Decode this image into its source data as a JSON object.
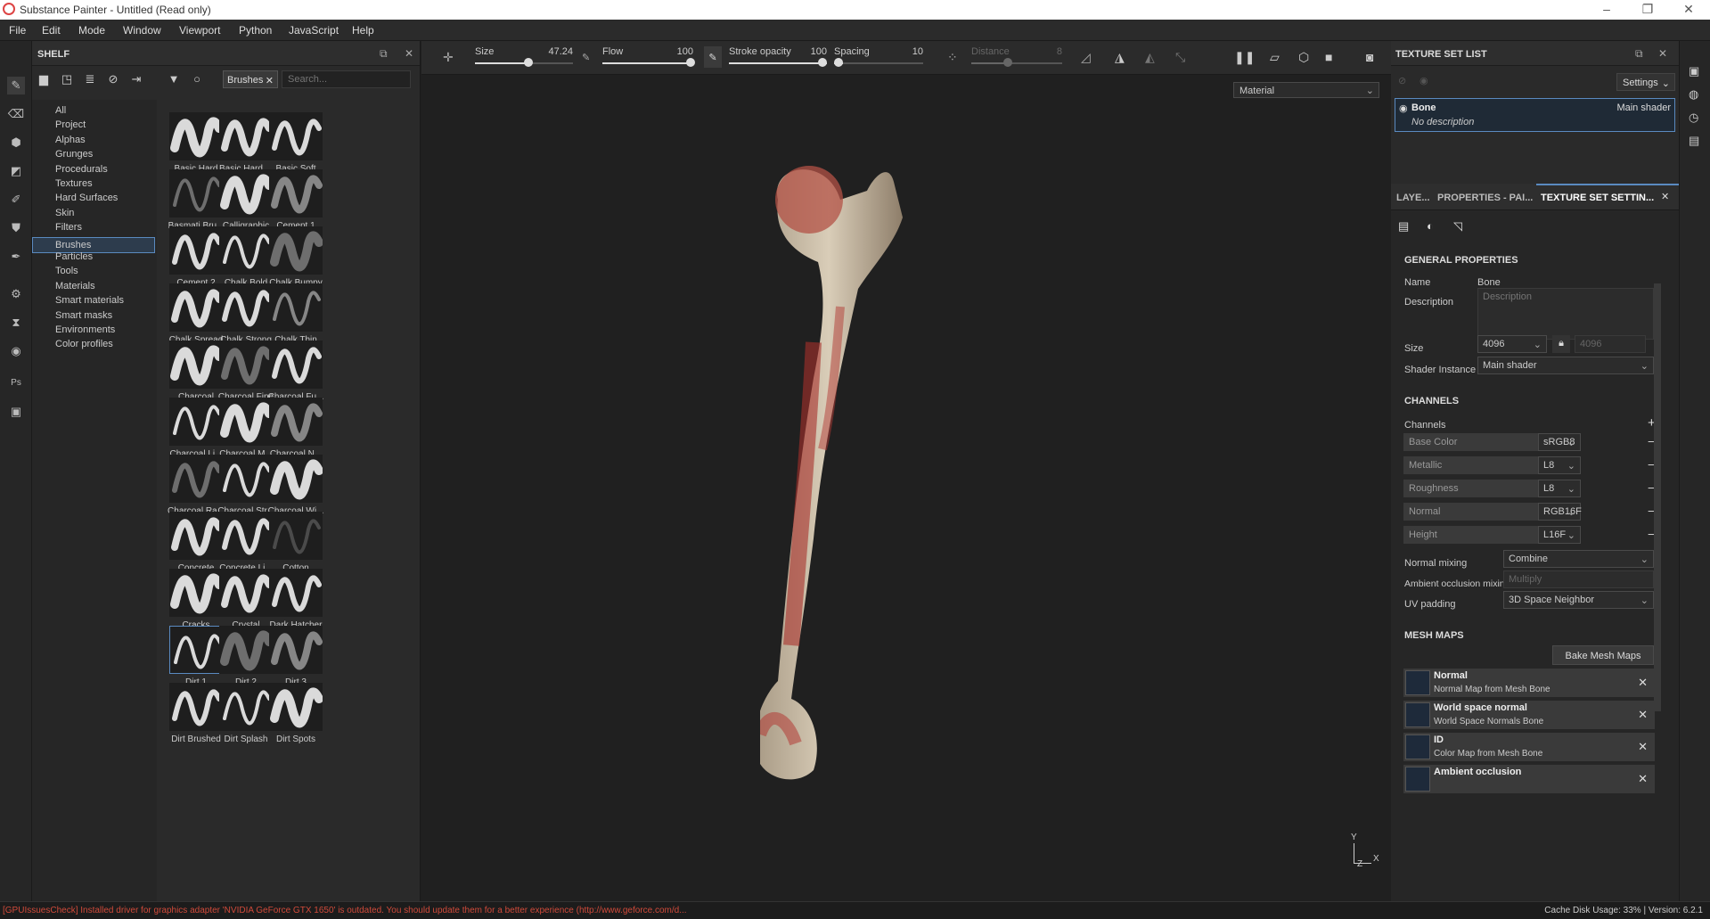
{
  "titlebar": {
    "title": "Substance Painter - Untitled (Read only)"
  },
  "menu": [
    "File",
    "Edit",
    "Mode",
    "Window",
    "Viewport",
    "Python",
    "JavaScript",
    "Help"
  ],
  "shelf": {
    "title": "SHELF",
    "filter_chip": "Brushes",
    "search_placeholder": "Search...",
    "categories": [
      "All",
      "Project",
      "Alphas",
      "Grunges",
      "Procedurals",
      "Textures",
      "Hard Surfaces",
      "Skin",
      "Filters",
      "Brushes",
      "Particles",
      "Tools",
      "Materials",
      "Smart materials",
      "Smart masks",
      "Environments",
      "Color profiles"
    ],
    "selected_category": "Brushes",
    "brushes": [
      "Basic Hard",
      "Basic Hard ...",
      "Basic Soft",
      "Basmati Bru...",
      "Calligraphic",
      "Cement 1",
      "Cement 2",
      "Chalk Bold",
      "Chalk Bumpy",
      "Chalk Spread",
      "Chalk Strong",
      "Chalk Thin",
      "Charcoal",
      "Charcoal Fine",
      "Charcoal Fu...",
      "Charcoal Li...",
      "Charcoal M...",
      "Charcoal N...",
      "Charcoal Ra...",
      "Charcoal Str...",
      "Charcoal Wi...",
      "Concrete",
      "Concrete Li...",
      "Cotton",
      "Cracks",
      "Crystal",
      "Dark Hatcher",
      "Dirt 1",
      "Dirt 2",
      "Dirt 3",
      "Dirt Brushed",
      "Dirt Splash",
      "Dirt Spots"
    ],
    "selected_brush": "Dirt 1"
  },
  "toolbar": {
    "size": {
      "label": "Size",
      "value": "47.24"
    },
    "flow": {
      "label": "Flow",
      "value": "100"
    },
    "stroke_opacity": {
      "label": "Stroke opacity",
      "value": "100"
    },
    "spacing": {
      "label": "Spacing",
      "value": "10"
    },
    "distance": {
      "label": "Distance",
      "value": "8"
    }
  },
  "viewport": {
    "material_select": "Material",
    "axis_y": "Y",
    "axis_z": "Z",
    "axis_x": "X"
  },
  "texture_set_list": {
    "title": "TEXTURE SET LIST",
    "settings": "Settings",
    "item": {
      "name": "Bone",
      "shader": "Main shader",
      "description": "No description"
    }
  },
  "tabs": [
    "LAYE...",
    "PROPERTIES - PAI...",
    "TEXTURE SET SETTIN..."
  ],
  "tss": {
    "general": "GENERAL PROPERTIES",
    "name_label": "Name",
    "name_value": "Bone",
    "description_label": "Description",
    "description_placeholder": "Description",
    "size_label": "Size",
    "size_value": "4096",
    "size_value2": "4096",
    "shader_label": "Shader Instance",
    "shader_value": "Main shader",
    "channels_title": "CHANNELS",
    "channels_label": "Channels",
    "channels": [
      {
        "name": "Base Color",
        "fmt": "sRGB8"
      },
      {
        "name": "Metallic",
        "fmt": "L8"
      },
      {
        "name": "Roughness",
        "fmt": "L8"
      },
      {
        "name": "Normal",
        "fmt": "RGB16F"
      },
      {
        "name": "Height",
        "fmt": "L16F"
      }
    ],
    "normal_mixing_label": "Normal mixing",
    "normal_mixing": "Combine",
    "ao_mixing_label": "Ambient occlusion mixing",
    "ao_mixing": "Multiply",
    "uv_padding_label": "UV padding",
    "uv_padding": "3D Space Neighbor",
    "mesh_maps_title": "MESH MAPS",
    "bake_button": "Bake Mesh Maps",
    "mesh_maps": [
      {
        "name": "Normal",
        "desc": "Normal Map from Mesh Bone"
      },
      {
        "name": "World space normal",
        "desc": "World Space Normals Bone"
      },
      {
        "name": "ID",
        "desc": "Color Map from Mesh Bone"
      },
      {
        "name": "Ambient occlusion",
        "desc": ""
      }
    ]
  },
  "status": {
    "warning": "[GPUIssuesCheck] Installed driver for graphics adapter 'NVIDIA GeForce GTX 1650' is outdated. You should update them for a better experience (http://www.geforce.com/d...",
    "right": "Cache Disk Usage:   33% | Version: 6.2.1"
  }
}
